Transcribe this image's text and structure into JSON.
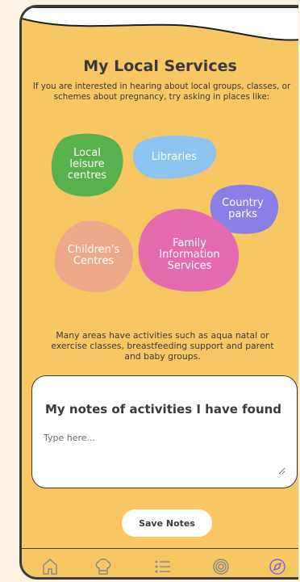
{
  "page": {
    "title": "My Local Services",
    "intro": "If you are interested in hearing about local groups, classes, or schemes about pregnancy, try asking in places like:"
  },
  "places": [
    {
      "line1": "Local",
      "line2": "leisure",
      "line3": "centres",
      "color": "#59b04f"
    },
    {
      "line1": "Libraries",
      "color": "#8cc4ef"
    },
    {
      "line1": "Country",
      "line2": "parks",
      "color": "#8b7ee6"
    },
    {
      "line1": "Children's",
      "line2": "Centres",
      "color": "#eda88a"
    },
    {
      "line1": "Family",
      "line2": "Information",
      "line3": "Services",
      "color": "#e46cae"
    }
  ],
  "activities_text": "Many areas have activities such as aqua natal or exercise classes, breastfeeding support and parent and baby groups.",
  "notes": {
    "title": "My notes of activities I have found",
    "placeholder": "Type here...",
    "value": ""
  },
  "save_button": {
    "label": "Save Notes"
  },
  "tabbar": {
    "items": [
      {
        "icon": "home-icon",
        "active": false
      },
      {
        "icon": "chef-hat-icon",
        "active": false
      },
      {
        "icon": "list-icon",
        "active": false
      },
      {
        "icon": "target-icon",
        "active": false
      },
      {
        "icon": "compass-icon",
        "active": true
      }
    ],
    "active_color": "#7b6ad8",
    "icon_color": "#8a8a8a"
  },
  "colors": {
    "background": "#f7c764",
    "text": "#3a3a3a"
  }
}
